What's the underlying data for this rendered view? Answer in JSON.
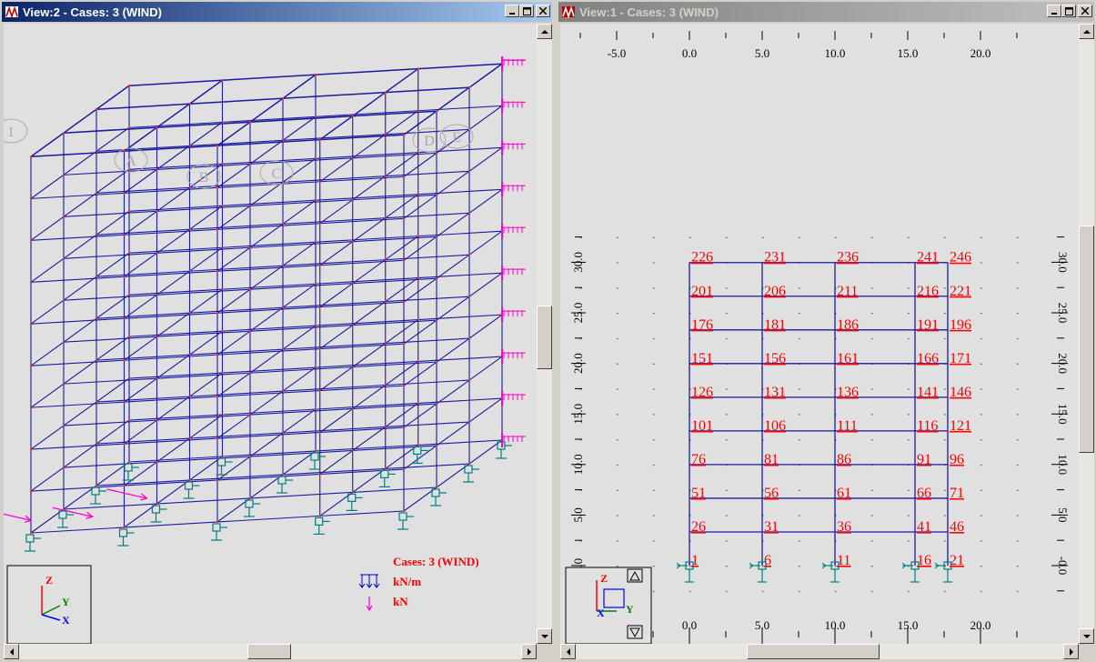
{
  "left_window": {
    "title": "View:2 - Cases: 3 (WIND)",
    "active": true,
    "legend": {
      "cases": "Cases: 3 (WIND)",
      "unit_distributed": "kN/m",
      "unit_point": "kN"
    },
    "axes": {
      "z": "Z",
      "y": "Y",
      "x": "X"
    },
    "grid_bubbles": [
      "1",
      "D",
      "E",
      "A",
      "B",
      "C"
    ]
  },
  "right_window": {
    "title": "View:1 - Cases: 3 (WIND)",
    "active": false,
    "x_ticks": [
      "-5.0",
      "0.0",
      "5.0",
      "10.0",
      "15.0",
      "20.0"
    ],
    "x_ticks_bottom": [
      "-5.0",
      "0.0",
      "5.0",
      "10.0",
      "15.0",
      "20.0"
    ],
    "y_ticks_left": [
      "30.0",
      "25.0",
      "20.0",
      "15.0",
      "10.0",
      "5.0",
      "0.0"
    ],
    "y_ticks_right": [
      "30.0",
      "25.0",
      "20.0",
      "15.0",
      "10.0",
      "5.0",
      "-0.0"
    ],
    "axes": {
      "z": "Z",
      "y": "Y",
      "x": "X"
    },
    "node_labels": [
      [
        "1",
        "6",
        "11",
        "16",
        "21"
      ],
      [
        "26",
        "31",
        "36",
        "41",
        "46"
      ],
      [
        "51",
        "56",
        "61",
        "66",
        "71"
      ],
      [
        "76",
        "81",
        "86",
        "91",
        "96"
      ],
      [
        "101",
        "106",
        "111",
        "116",
        "121"
      ],
      [
        "126",
        "131",
        "136",
        "141",
        "146"
      ],
      [
        "151",
        "156",
        "161",
        "166",
        "171"
      ],
      [
        "176",
        "181",
        "186",
        "191",
        "196"
      ],
      [
        "201",
        "206",
        "211",
        "216",
        "221"
      ],
      [
        "226",
        "231",
        "236",
        "241",
        "246"
      ]
    ]
  },
  "colors": {
    "frame": "#1a1aa0",
    "labels": "#ff0000",
    "supports": "#008080",
    "wind": "#ff00cc",
    "grid_dot": "#555555"
  }
}
